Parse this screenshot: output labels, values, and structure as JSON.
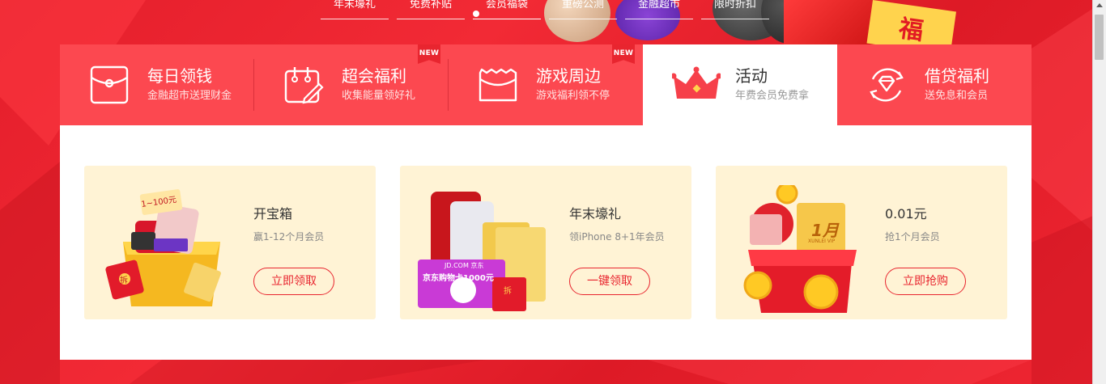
{
  "top_nav": {
    "items": [
      {
        "label": "年末壕礼"
      },
      {
        "label": "免费补贴"
      },
      {
        "label": "会员福袋"
      },
      {
        "label": "重磅公测"
      },
      {
        "label": "金融超市"
      },
      {
        "label": "限时折扣"
      }
    ],
    "fu_char": "福"
  },
  "tabs": [
    {
      "title": "每日领钱",
      "subtitle": "金融超市送理财金",
      "icon": "red-envelope-icon",
      "badge": ""
    },
    {
      "title": "超会福利",
      "subtitle": "收集能量领好礼",
      "icon": "calendar-edit-icon",
      "badge": "NEW"
    },
    {
      "title": "游戏周边",
      "subtitle": "游戏福利领不停",
      "icon": "ticket-icon",
      "badge": "NEW"
    },
    {
      "title": "活动",
      "subtitle": "年费会员免费拿",
      "icon": "crown-icon",
      "badge": ""
    },
    {
      "title": "借贷福利",
      "subtitle": "送免息和会员",
      "icon": "diamond-refresh-icon",
      "badge": ""
    }
  ],
  "cards": [
    {
      "title": "开宝箱",
      "subtitle": "赢1-12个月会员",
      "button": "立即领取",
      "art": {
        "tag": "1~100元",
        "envelope": "拆"
      }
    },
    {
      "title": "年末壕礼",
      "subtitle": "领iPhone 8+1年会员",
      "button": "一键领取",
      "art": {
        "jd": "JD.COM 京东",
        "card_text": "京东购物卡1000元",
        "envelope": "拆"
      }
    },
    {
      "title": "0.01元",
      "subtitle": "抢1个月会员",
      "button": "立即抢购",
      "art": {
        "month": "1月",
        "vip": "XUNLEI VIP"
      }
    }
  ],
  "colors": {
    "accent": "#fc4850",
    "button_red": "#e8252f",
    "card_bg": "#fff3d5",
    "page_red": "#e41e2b"
  }
}
